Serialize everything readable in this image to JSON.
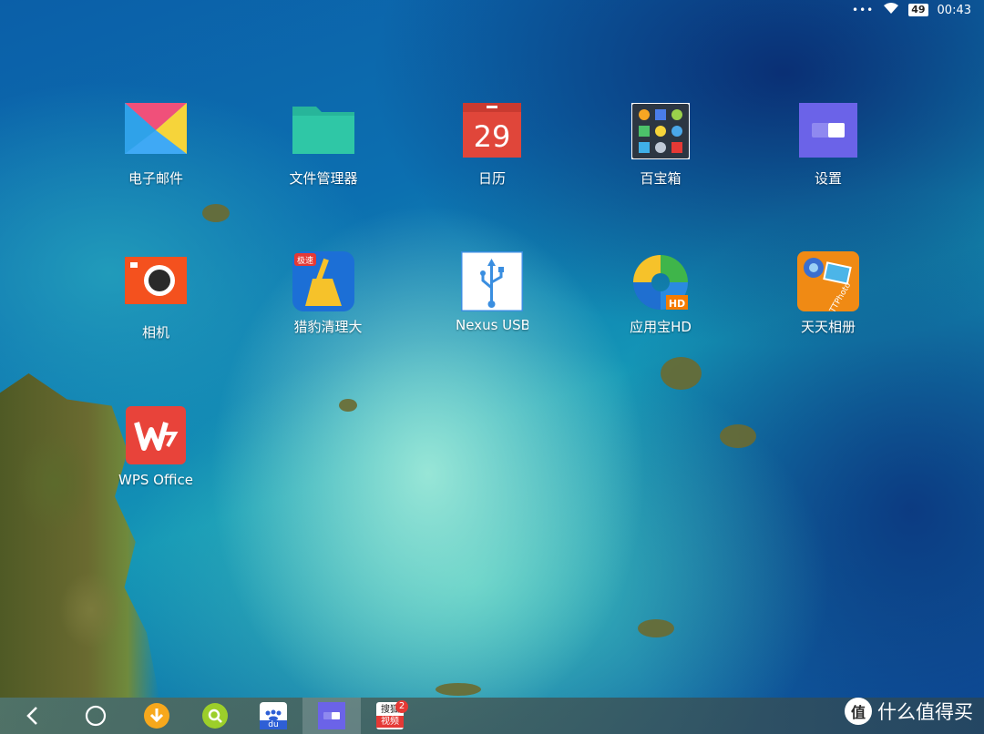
{
  "status_bar": {
    "time": "00:43",
    "battery": "49",
    "more": "•••"
  },
  "apps": [
    {
      "id": "email",
      "label": "电子邮件",
      "icon": "email-icon"
    },
    {
      "id": "files",
      "label": "文件管理器",
      "icon": "folder-icon"
    },
    {
      "id": "calendar",
      "label": "日历",
      "icon": "calendar-icon",
      "day": "29"
    },
    {
      "id": "toolbox",
      "label": "百宝箱",
      "icon": "toolbox-icon"
    },
    {
      "id": "settings",
      "label": "设置",
      "icon": "settings-icon"
    },
    {
      "id": "camera",
      "label": "相机",
      "icon": "camera-icon"
    },
    {
      "id": "cleaner",
      "label": "猎豹清理大",
      "icon": "broom-icon",
      "tag": "极速"
    },
    {
      "id": "nexus-usb",
      "label": "Nexus USB",
      "icon": "usb-icon"
    },
    {
      "id": "app-store",
      "label": "应用宝HD",
      "icon": "app-store-icon",
      "tag": "HD"
    },
    {
      "id": "photo-album",
      "label": "天天相册",
      "icon": "photo-album-icon",
      "tag": "TTPhoto"
    },
    {
      "id": "wps",
      "label": "WPS Office",
      "icon": "wps-icon"
    }
  ],
  "dock": {
    "baidu_text": "du",
    "sohu_text_1": "搜狐",
    "sohu_text_2": "视频",
    "sohu_badge": "2"
  },
  "watermark": {
    "glyph": "值",
    "text": "什么值得买"
  }
}
